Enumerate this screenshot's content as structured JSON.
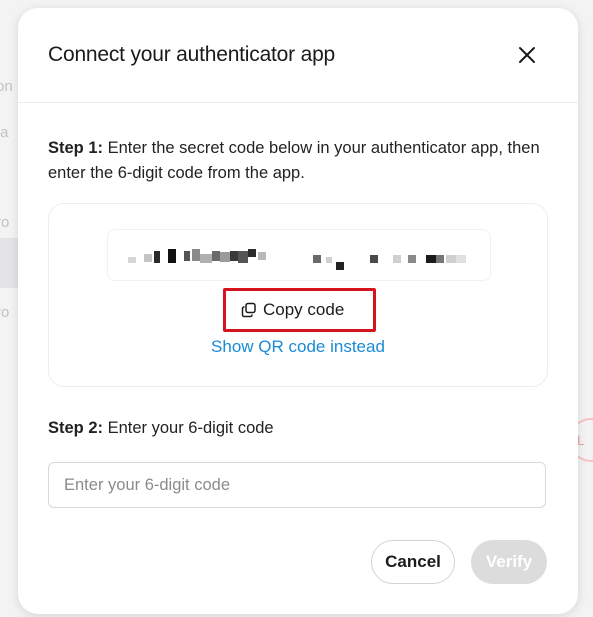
{
  "modal": {
    "title": "Connect your authenticator app",
    "close_icon": "close-icon"
  },
  "step1": {
    "label": "Step 1:",
    "text": " Enter the secret code below in your authenticator app, then enter the 6-digit code from the app.",
    "secret_code_state": "blurred",
    "copy_label": "Copy code",
    "copy_icon": "copy-icon",
    "qr_link": "Show QR code instead"
  },
  "step2": {
    "label": "Step 2:",
    "text": " Enter your 6-digit code",
    "input_value": "",
    "input_placeholder": "Enter your 6-digit code"
  },
  "actions": {
    "cancel_label": "Cancel",
    "verify_label": "Verify"
  },
  "colors": {
    "link": "#1a8bd6",
    "highlight": "#d6141d",
    "verify_disabled_bg": "#dcdcdc"
  }
}
